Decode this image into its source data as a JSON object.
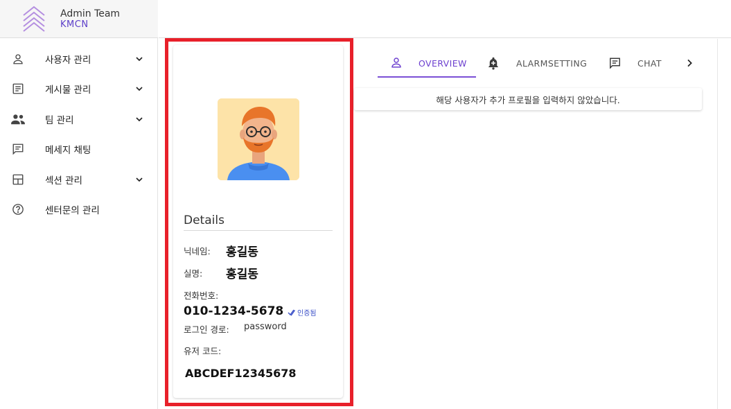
{
  "brand": {
    "title": "Admin Team",
    "subtitle": "KMCN"
  },
  "sidebar": {
    "items": [
      {
        "label": "사용자 관리",
        "icon": "user-icon",
        "expandable": true
      },
      {
        "label": "게시물 관리",
        "icon": "article-icon",
        "expandable": true
      },
      {
        "label": "팀 관리",
        "icon": "group-icon",
        "expandable": true
      },
      {
        "label": "메세지 채팅",
        "icon": "chat-icon",
        "expandable": false
      },
      {
        "label": "섹션 관리",
        "icon": "layout-icon",
        "expandable": true
      },
      {
        "label": "센터문의 관리",
        "icon": "help-icon",
        "expandable": false
      }
    ]
  },
  "profile": {
    "details_title": "Details",
    "nickname_label": "닉네임:",
    "nickname": "홍길동",
    "realname_label": "실명:",
    "realname": "홍길동",
    "phone_label": "전화번호:",
    "phone": "010-1234-5678",
    "verified": "인증됨",
    "login_label": "로그인 경로:",
    "login_value": "password",
    "usercode_label": "유저 코드:",
    "usercode": "ABCDEF12345678"
  },
  "tabs": [
    {
      "label": "OVERVIEW",
      "icon": "user-icon",
      "active": true
    },
    {
      "label": "ALARMSETTING",
      "icon": "bell-plus-icon",
      "active": false
    },
    {
      "label": "CHAT",
      "icon": "chat-icon",
      "active": false
    }
  ],
  "notice": "해당 사용자가 추가 프로필을 입력하지 않았습니다.",
  "colors": {
    "accent": "#6c3fcf",
    "highlight": "#e8202a",
    "verified": "#3a4fc7"
  }
}
